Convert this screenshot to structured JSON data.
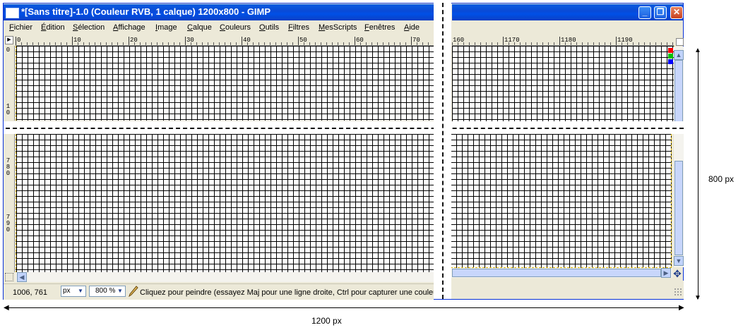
{
  "window": {
    "title": "*[Sans titre]-1.0 (Couleur RVB, 1 calque) 1200x800 - GIMP",
    "minimize_glyph": "_",
    "maximize_glyph": "❐",
    "close_glyph": "✕"
  },
  "menu": {
    "items": [
      {
        "label": "Fichier"
      },
      {
        "label": "Édition"
      },
      {
        "label": "Sélection"
      },
      {
        "label": "Affichage"
      },
      {
        "label": "Image"
      },
      {
        "label": "Calque"
      },
      {
        "label": "Couleurs"
      },
      {
        "label": "Outils"
      },
      {
        "label": "Filtres"
      },
      {
        "label": "MesScripts"
      },
      {
        "label": "Fenêtres"
      },
      {
        "label": "Aide"
      }
    ]
  },
  "rulers": {
    "horizontal_left_ticks": [
      "0",
      "10",
      "20",
      "30",
      "40",
      "50",
      "60",
      "70"
    ],
    "horizontal_right_ticks": [
      "160",
      "1170",
      "1180",
      "1190"
    ],
    "vertical_top_labels": [
      "0",
      "1",
      "0"
    ],
    "vertical_bottom_labels_a": [
      "7",
      "8",
      "0"
    ],
    "vertical_bottom_labels_b": [
      "7",
      "9",
      "0"
    ]
  },
  "colors": {
    "title_bar": "#0a4ad6",
    "guide_dash": "#d8b000",
    "red_marker": "#ff0000",
    "green_marker": "#00c000",
    "blue_marker": "#0000ff"
  },
  "status": {
    "coordinates": "1006, 761",
    "unit": "px",
    "zoom": "800 %",
    "message": "Cliquez pour peindre (essayez Maj pour une ligne droite, Ctrl pour capturer une couleur"
  },
  "annotations": {
    "width_label": "1200 px",
    "height_label": "800 px"
  },
  "icons": {
    "nav": "navigate-icon",
    "pencil": "pencil-icon",
    "move": "move-navigation-icon"
  }
}
